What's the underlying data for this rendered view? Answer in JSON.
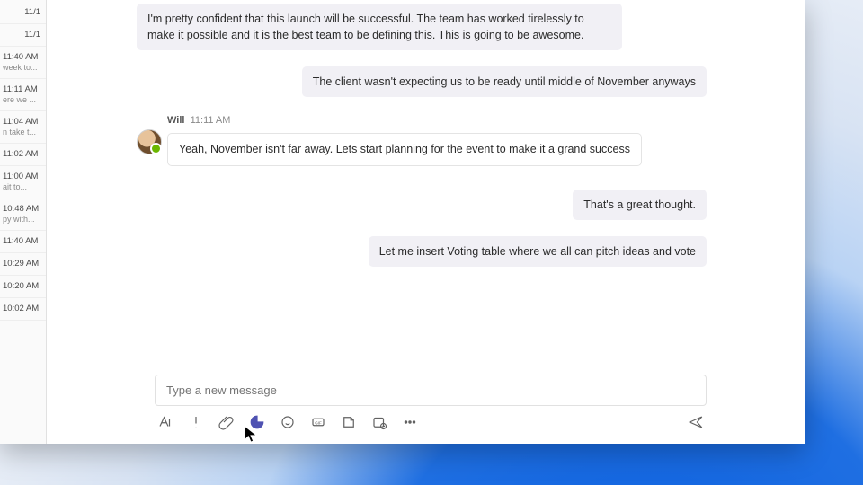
{
  "rail": [
    {
      "t1": "11/1",
      "t2": "",
      "align": "right"
    },
    {
      "t1": "11/1",
      "t2": "",
      "align": "right"
    },
    {
      "t1": "11:40 AM",
      "t2": "week to..."
    },
    {
      "t1": "11:11 AM",
      "t2": "ere we ..."
    },
    {
      "t1": "11:04 AM",
      "t2": "n take t..."
    },
    {
      "t1": "11:02 AM",
      "t2": ""
    },
    {
      "t1": "11:00 AM",
      "t2": "ait to..."
    },
    {
      "t1": "10:48 AM",
      "t2": "py with..."
    },
    {
      "t1": "11:40 AM",
      "t2": ""
    },
    {
      "t1": "10:29 AM",
      "t2": ""
    },
    {
      "t1": "10:20 AM",
      "t2": ""
    },
    {
      "t1": "10:02 AM",
      "t2": ""
    }
  ],
  "messages": {
    "m1": "I'm pretty confident that this launch will be successful. The team has worked tirelessly to make it possible and it is the best team to be defining this. This is going to be awesome.",
    "m2": "The client wasn't expecting us to be ready until middle of November anyways",
    "sender_name": "Will",
    "sender_time": "11:11 AM",
    "m3": "Yeah, November isn't far away. Lets start planning for the event to make it a grand success",
    "m4": "That's a great thought.",
    "m5": "Let me insert Voting table where we all can pitch ideas and vote"
  },
  "compose": {
    "placeholder": "Type a new message"
  },
  "toolbar": {
    "format": "format-icon",
    "priority": "priority-icon",
    "attach": "attach-icon",
    "loop": "loop-icon",
    "emoji": "emoji-icon",
    "gif": "gif-icon",
    "sticker": "sticker-icon",
    "schedule": "schedule-icon",
    "more": "more-icon",
    "send": "send-icon"
  }
}
